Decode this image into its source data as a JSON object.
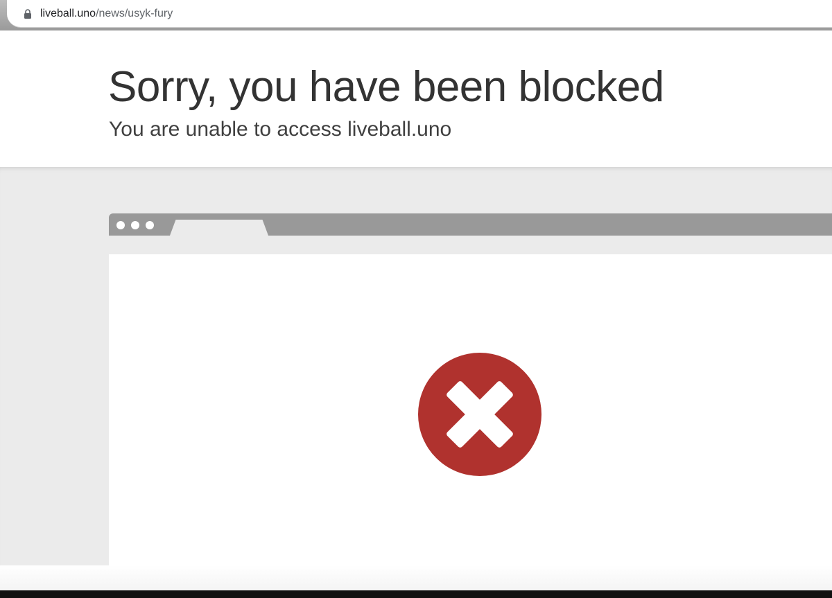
{
  "browser": {
    "url_domain": "liveball.uno",
    "url_path": "/news/usyk-fury",
    "lock_icon": "lock-icon"
  },
  "page": {
    "title": "Sorry, you have been blocked",
    "subtitle": "You are unable to access liveball.uno"
  },
  "illustration": {
    "icon": "blocked-x-icon",
    "icon_color": "#b0322e",
    "tabbar_color": "#999999",
    "background_color": "#ebebeb"
  }
}
